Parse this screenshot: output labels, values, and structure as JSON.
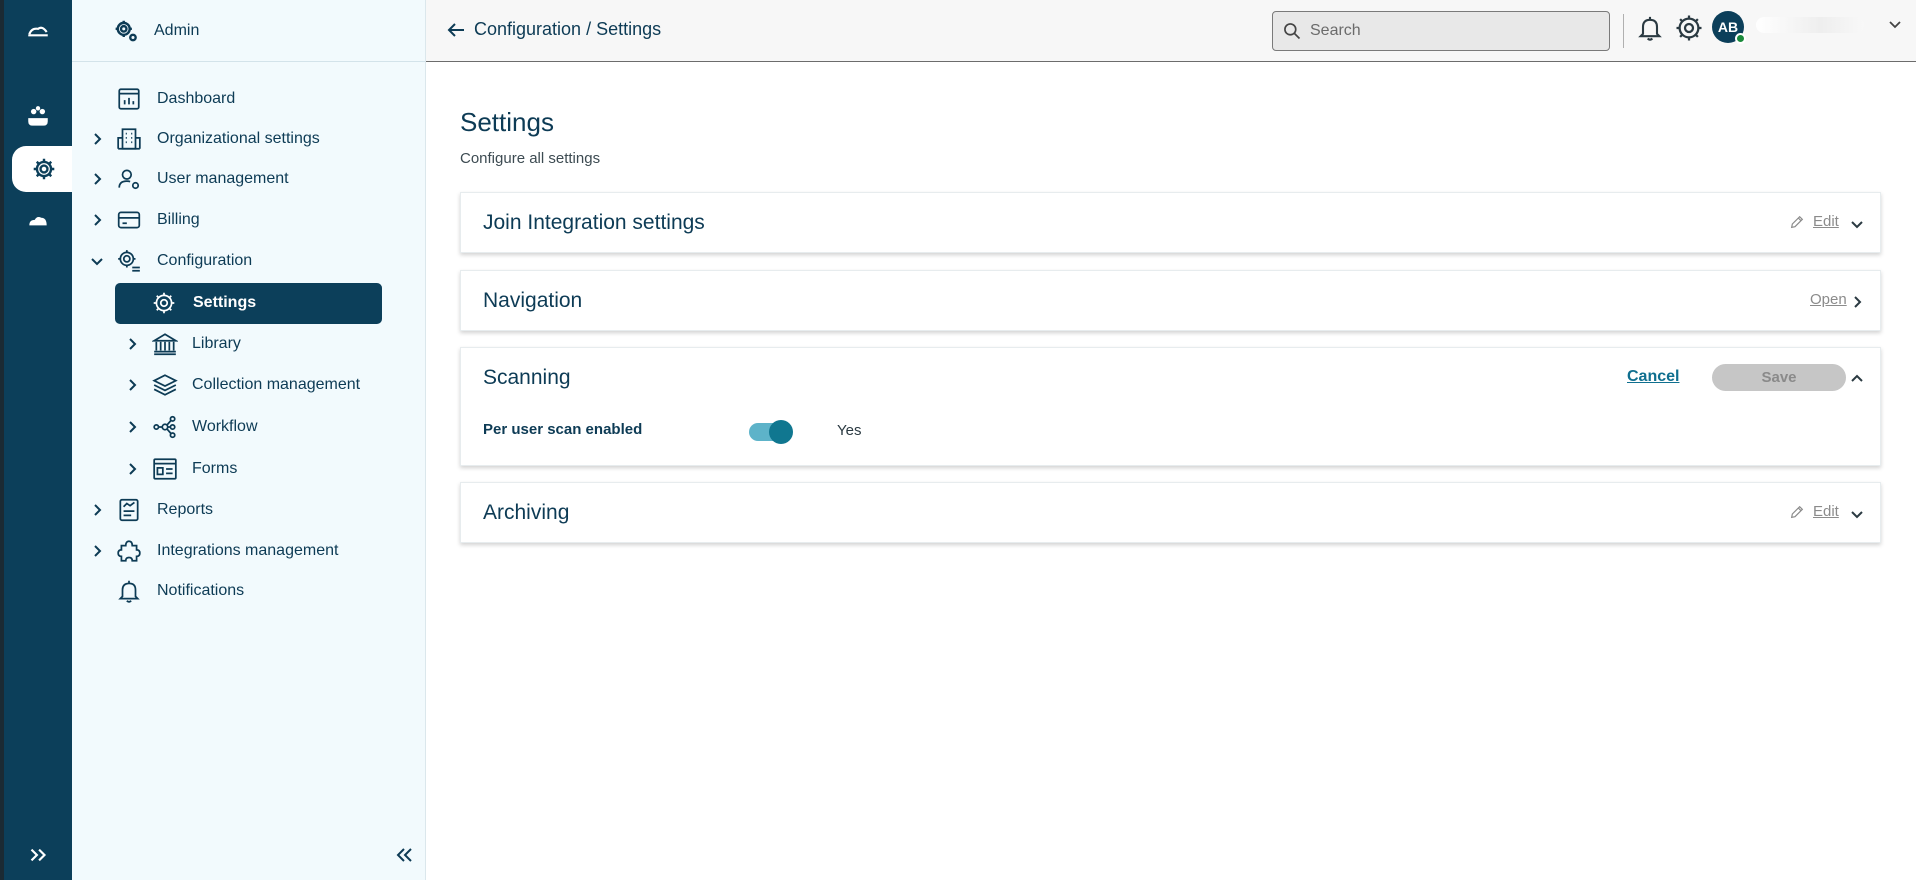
{
  "sidebar": {
    "header": "Admin",
    "items": [
      {
        "label": "Dashboard"
      },
      {
        "label": "Organizational settings"
      },
      {
        "label": "User management"
      },
      {
        "label": "Billing"
      },
      {
        "label": "Configuration"
      },
      {
        "label": "Settings"
      },
      {
        "label": "Library"
      },
      {
        "label": "Collection management"
      },
      {
        "label": "Workflow"
      },
      {
        "label": "Forms"
      },
      {
        "label": "Reports"
      },
      {
        "label": "Integrations management"
      },
      {
        "label": "Notifications"
      }
    ]
  },
  "topbar": {
    "breadcrumb": "Configuration / Settings",
    "search_placeholder": "Search",
    "avatar_initials": "AB"
  },
  "main": {
    "title": "Settings",
    "subtitle": "Configure all settings",
    "cards": [
      {
        "title": "Join Integration settings",
        "action": "Edit"
      },
      {
        "title": "Navigation",
        "action": "Open"
      },
      {
        "title": "Scanning",
        "cancel": "Cancel",
        "save": "Save",
        "field_label": "Per user scan enabled",
        "field_value": "Yes"
      },
      {
        "title": "Archiving",
        "action": "Edit"
      }
    ]
  },
  "icons": {
    "rail": [
      "cloud-logo-icon",
      "users-hands-icon",
      "gear-icon",
      "cloud-icon",
      "expand-double-chevron-icon"
    ]
  },
  "colors": {
    "primary": "#0c3f5a",
    "accent": "#107790",
    "sidebar_bg": "#f2fafd"
  }
}
